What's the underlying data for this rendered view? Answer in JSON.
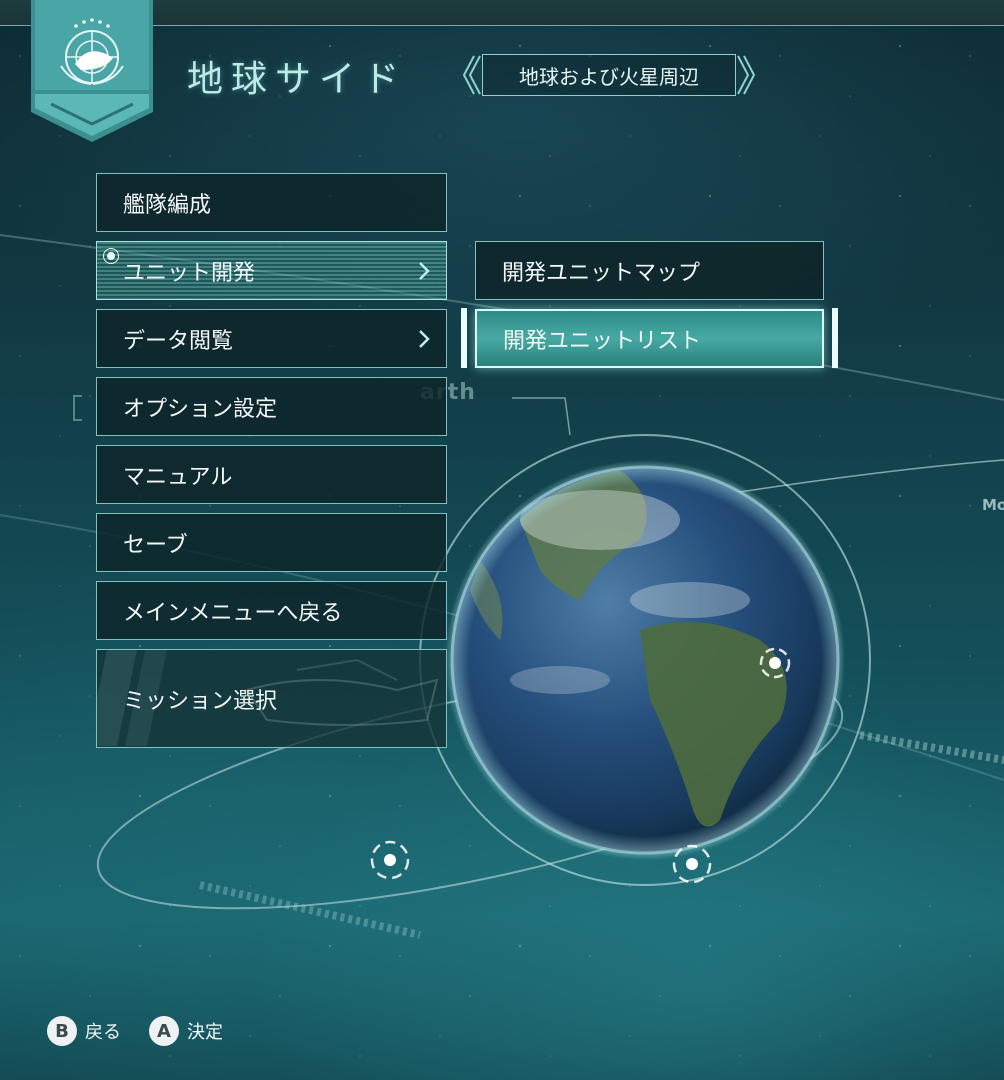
{
  "header": {
    "title": "地球サイド",
    "region": "地球および火星周辺"
  },
  "main_menu": {
    "items": [
      {
        "label": "艦隊編成"
      },
      {
        "label": "ユニット開発"
      },
      {
        "label": "データ閲覧"
      },
      {
        "label": "オプション設定"
      },
      {
        "label": "マニュアル"
      },
      {
        "label": "セーブ"
      },
      {
        "label": "メインメニューへ戻る"
      },
      {
        "label": "ミッション選択"
      }
    ]
  },
  "sub_menu": {
    "items": [
      {
        "label": "開発ユニットマップ"
      },
      {
        "label": "開発ユニットリスト"
      }
    ]
  },
  "map_labels": {
    "earth": "arth",
    "moon": "Mo"
  },
  "button_hints": [
    {
      "button": "B",
      "label": "戻る"
    },
    {
      "button": "A",
      "label": "決定"
    }
  ],
  "colors": {
    "accent": "#7dc2bf",
    "selected": "#46a9a3",
    "panel": "#0e2428"
  },
  "icons": [
    "federation-emblem-icon",
    "chevron-right-icon",
    "radio-selected-icon",
    "orbit-marker-icon"
  ]
}
